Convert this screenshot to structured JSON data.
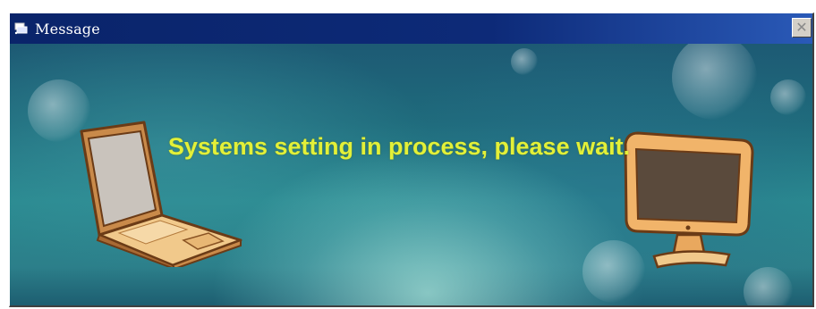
{
  "window": {
    "title": "Message",
    "close_glyph": "✕",
    "title_icon": "app-icon"
  },
  "content": {
    "message": "Systems setting in process, please wait.",
    "left_illustration": "laptop-icon",
    "right_illustration": "monitor-icon",
    "message_color": "#e3f038"
  },
  "colors": {
    "titlebar_start": "#0a246a",
    "titlebar_end": "#2a5ab8",
    "window_face": "#d4d0c8"
  }
}
